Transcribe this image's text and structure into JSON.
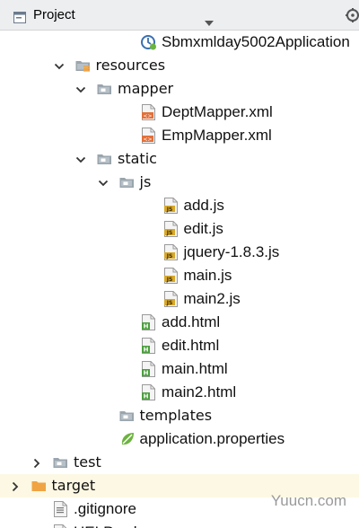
{
  "header": {
    "title": "Project",
    "project_icon": "project-window-icon",
    "dropdown_icon": "triangle-down-icon",
    "settings_icon": "gear-icon"
  },
  "tree": [
    {
      "label": "Sbmxmlday5002Application",
      "icon": "spring-boot-app-icon",
      "arrow": "none",
      "indent": 6,
      "selected": false
    },
    {
      "label": "resources",
      "icon": "resources-folder-icon",
      "arrow": "down",
      "indent": 3,
      "selected": false
    },
    {
      "label": "mapper",
      "icon": "folder-icon",
      "arrow": "down",
      "indent": 4,
      "selected": false
    },
    {
      "label": "DeptMapper.xml",
      "icon": "xml-file-icon",
      "arrow": "none",
      "indent": 6,
      "selected": false
    },
    {
      "label": "EmpMapper.xml",
      "icon": "xml-file-icon",
      "arrow": "none",
      "indent": 6,
      "selected": false
    },
    {
      "label": "static",
      "icon": "folder-icon",
      "arrow": "down",
      "indent": 4,
      "selected": false
    },
    {
      "label": "js",
      "icon": "folder-icon",
      "arrow": "down",
      "indent": 5,
      "selected": false
    },
    {
      "label": "add.js",
      "icon": "js-file-icon",
      "arrow": "none",
      "indent": 7,
      "selected": false
    },
    {
      "label": "edit.js",
      "icon": "js-file-icon",
      "arrow": "none",
      "indent": 7,
      "selected": false
    },
    {
      "label": "jquery-1.8.3.js",
      "icon": "js-file-icon",
      "arrow": "none",
      "indent": 7,
      "selected": false
    },
    {
      "label": "main.js",
      "icon": "js-file-icon",
      "arrow": "none",
      "indent": 7,
      "selected": false
    },
    {
      "label": "main2.js",
      "icon": "js-file-icon",
      "arrow": "none",
      "indent": 7,
      "selected": false
    },
    {
      "label": "add.html",
      "icon": "html-file-icon",
      "arrow": "none",
      "indent": 6,
      "selected": false
    },
    {
      "label": "edit.html",
      "icon": "html-file-icon",
      "arrow": "none",
      "indent": 6,
      "selected": false
    },
    {
      "label": "main.html",
      "icon": "html-file-icon",
      "arrow": "none",
      "indent": 6,
      "selected": false
    },
    {
      "label": "main2.html",
      "icon": "html-file-icon",
      "arrow": "none",
      "indent": 6,
      "selected": false
    },
    {
      "label": "templates",
      "icon": "folder-icon",
      "arrow": "none",
      "indent": 5,
      "selected": false
    },
    {
      "label": "application.properties",
      "icon": "properties-file-icon",
      "arrow": "none",
      "indent": 5,
      "selected": false
    },
    {
      "label": "test",
      "icon": "folder-icon",
      "arrow": "right",
      "indent": 2,
      "selected": false
    },
    {
      "label": "target",
      "icon": "orange-folder-icon",
      "arrow": "right",
      "indent": 1,
      "selected": true
    },
    {
      "label": ".gitignore",
      "icon": "text-file-icon",
      "arrow": "none",
      "indent": 2,
      "selected": false
    },
    {
      "label": "HELP.md",
      "icon": "markdown-file-icon",
      "arrow": "none",
      "indent": 2,
      "selected": false
    }
  ],
  "watermark": "Yuucn.com",
  "colors": {
    "selection": "#fcf8e3",
    "xml": "#e2703a",
    "js": "#d8a82a",
    "html": "#4c9e3f",
    "folder": "#9aa5ad",
    "orange_folder": "#f0a443",
    "spring": "#6db33f",
    "header_bg": "#eceef0"
  }
}
